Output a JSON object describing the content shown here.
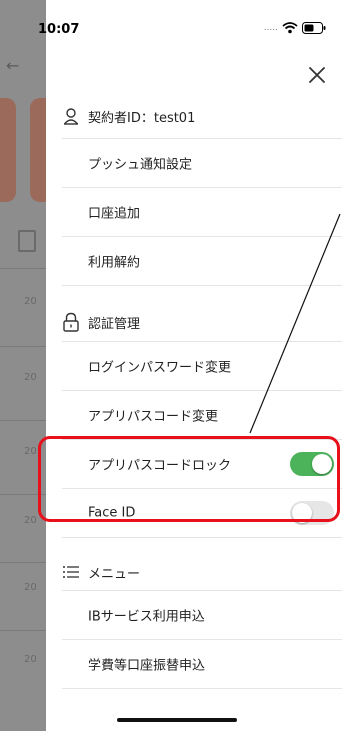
{
  "status_bar": {
    "time": "10:07",
    "dots": "....."
  },
  "background": {
    "years": [
      "20",
      "20",
      "20",
      "20",
      "20",
      "20"
    ]
  },
  "drawer": {
    "close_icon": "close-icon",
    "account": {
      "icon": "person-icon",
      "label": "契約者ID：test01"
    },
    "account_items": [
      {
        "label": "プッシュ通知設定"
      },
      {
        "label": "口座追加"
      },
      {
        "label": "利用解約"
      }
    ],
    "auth": {
      "icon": "lock-icon",
      "label": "認証管理"
    },
    "auth_items": [
      {
        "label": "ログインパスワード変更"
      },
      {
        "label": "アプリパスコード変更"
      }
    ],
    "toggles": [
      {
        "label": "アプリパスコードロック",
        "state": "on"
      },
      {
        "label": "Face ID",
        "state": "off"
      }
    ],
    "menu": {
      "icon": "list-icon",
      "label": "メニュー"
    },
    "menu_items": [
      {
        "label": "IBサービス利用申込"
      },
      {
        "label": "学費等口座振替申込"
      }
    ]
  },
  "colors": {
    "toggle_on": "#4cb35a",
    "toggle_off": "#e6e6e6",
    "highlight": "#e8101a",
    "overlay": "#8d8d8d"
  }
}
